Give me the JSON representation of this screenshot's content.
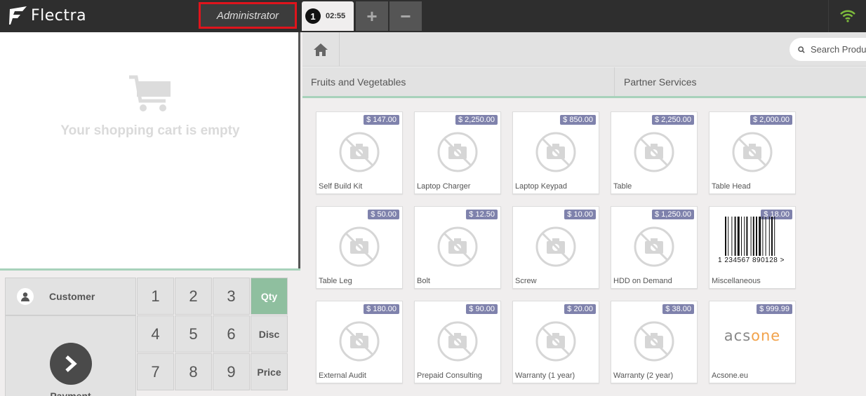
{
  "app": {
    "logo_text": "Flectra"
  },
  "header": {
    "user_label": "Administrator",
    "order": {
      "number": "1",
      "time": "02:55"
    },
    "add_label": "+",
    "remove_label": "−"
  },
  "cart": {
    "empty_message": "Your shopping cart is empty"
  },
  "controls": {
    "customer_label": "Customer",
    "payment_label": "Payment",
    "keys": [
      "1",
      "2",
      "3",
      "4",
      "5",
      "6",
      "7",
      "8",
      "9"
    ],
    "modes": {
      "qty": "Qty",
      "disc": "Disc",
      "price": "Price"
    },
    "active_mode": "Qty"
  },
  "search": {
    "placeholder": "Search Products"
  },
  "categories": [
    "Fruits and Vegetables",
    "Partner Services"
  ],
  "products": [
    {
      "name": "Self Build Kit",
      "price": "$ 147.00"
    },
    {
      "name": "Laptop Charger",
      "price": "$ 2,250.00"
    },
    {
      "name": "Laptop Keypad",
      "price": "$ 850.00"
    },
    {
      "name": "Table",
      "price": "$ 2,250.00"
    },
    {
      "name": "Table Head",
      "price": "$ 2,000.00"
    },
    {
      "name": "Table Leg",
      "price": "$ 50.00"
    },
    {
      "name": "Bolt",
      "price": "$ 12.50"
    },
    {
      "name": "Screw",
      "price": "$ 10.00"
    },
    {
      "name": "HDD on Demand",
      "price": "$ 1,250.00"
    },
    {
      "name": "Miscellaneous",
      "price": "$ 18.00",
      "barcode_text": "1 234567 890128 >"
    },
    {
      "name": "External Audit",
      "price": "$ 180.00"
    },
    {
      "name": "Prepaid Consulting",
      "price": "$ 90.00"
    },
    {
      "name": "Warranty (1 year)",
      "price": "$ 20.00"
    },
    {
      "name": "Warranty (2 year)",
      "price": "$ 38.00"
    },
    {
      "name": "Acsone.eu",
      "price": "$ 999.99",
      "logo_text": {
        "part1": "acs",
        "part2": "one"
      }
    }
  ],
  "colors": {
    "accent_green": "#8fbf9f",
    "price_badge": "#7f82ac",
    "highlight_red": "#e0141c",
    "wifi_green": "#7dbb3c"
  }
}
